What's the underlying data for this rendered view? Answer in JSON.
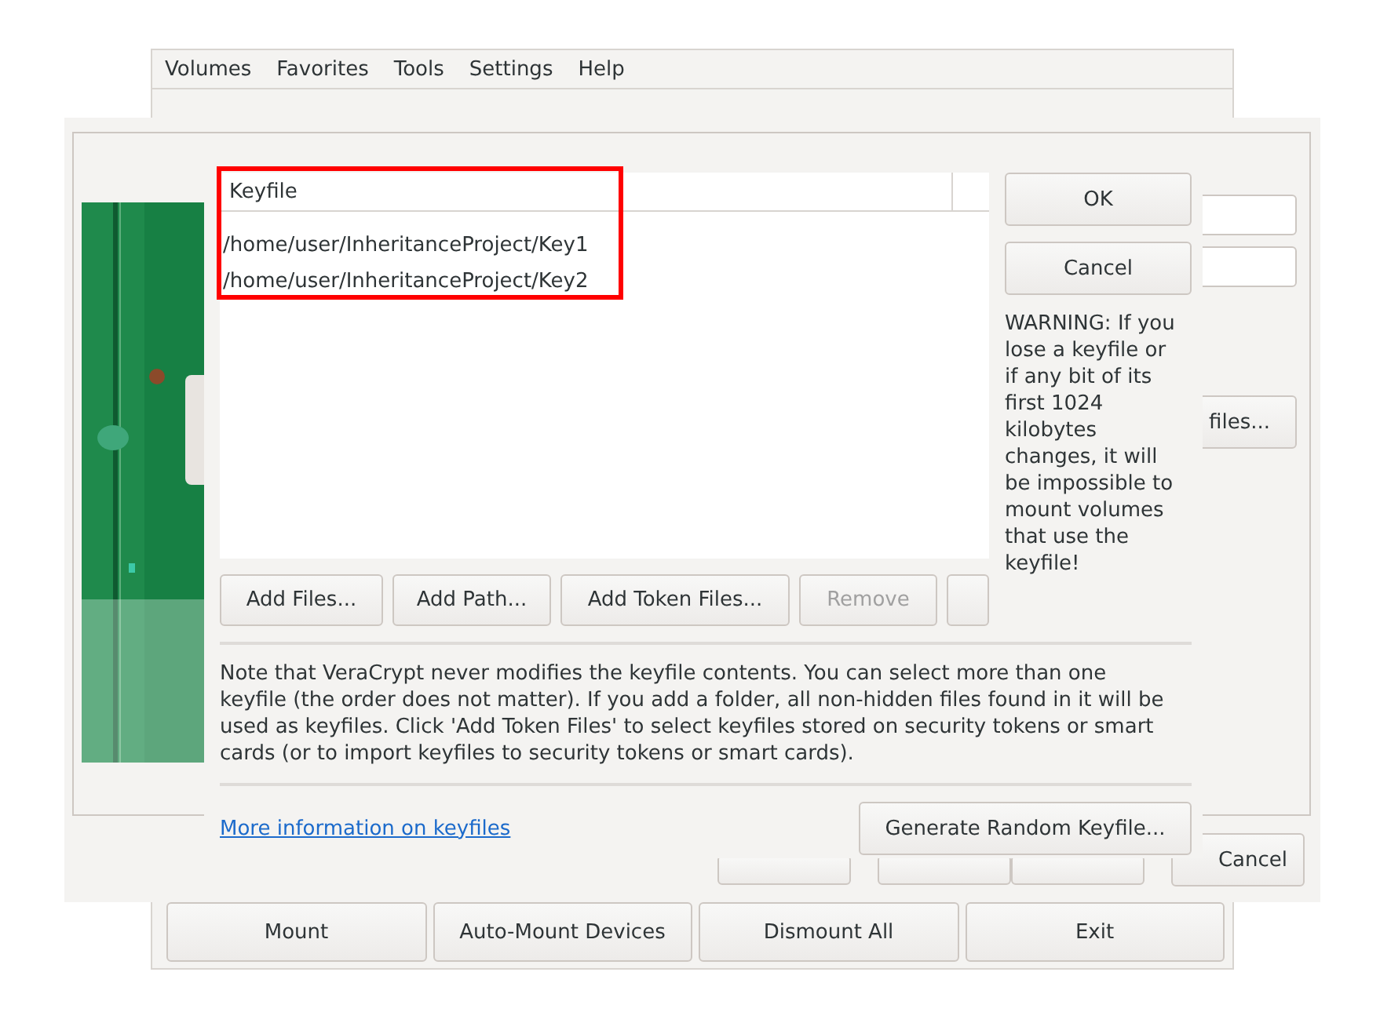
{
  "main_window": {
    "menu": [
      "Volumes",
      "Favorites",
      "Tools",
      "Settings",
      "Help"
    ],
    "buttons": [
      "Mount",
      "Auto-Mount Devices",
      "Dismount All",
      "Exit"
    ]
  },
  "back_dialog": {
    "side_button": "files...",
    "cancel_button": "Cancel"
  },
  "keyfiles_dialog": {
    "table": {
      "columns": [
        "Keyfile"
      ],
      "rows": [
        "/home/user/InheritanceProject/Key1",
        "/home/user/InheritanceProject/Key2"
      ]
    },
    "list_buttons": [
      {
        "label": "Add Files...",
        "disabled": false
      },
      {
        "label": "Add Path...",
        "disabled": false
      },
      {
        "label": "Add Token Files...",
        "disabled": false
      },
      {
        "label": "Remove",
        "disabled": true
      }
    ],
    "ok": "OK",
    "cancel": "Cancel",
    "warning": "WARNING: If you lose a keyfile or if any bit of its first 1024 kilobytes changes, it will be impossible to mount volumes that use the keyfile!",
    "note": "Note that VeraCrypt never modifies the keyfile contents. You can select more than one keyfile (the order does not matter). If you add a folder, all non-hidden files found in it will be used as keyfiles. Click 'Add Token Files' to select keyfiles stored on security tokens or smart cards (or to import keyfiles to security tokens or smart cards).",
    "link": "More information on keyfiles",
    "generate": "Generate Random Keyfile..."
  }
}
